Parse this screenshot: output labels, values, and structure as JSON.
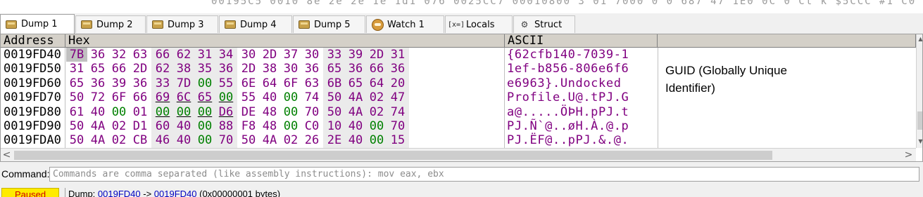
{
  "top_strip": {
    "ghost_text": "00195C5  0010 8e  2e  2e 1e 1d1 076  0025CC7 00010800  3  01  7000  0 0  687 47  1E0  0C 0  Ct  k  $5CCC  #1  C0"
  },
  "tabs": [
    {
      "label": "Dump 1",
      "icon": "dump-icon",
      "active": true
    },
    {
      "label": "Dump 2",
      "icon": "dump-icon",
      "active": false
    },
    {
      "label": "Dump 3",
      "icon": "dump-icon",
      "active": false
    },
    {
      "label": "Dump 4",
      "icon": "dump-icon",
      "active": false
    },
    {
      "label": "Dump 5",
      "icon": "dump-icon",
      "active": false
    },
    {
      "label": "Watch 1",
      "icon": "watch-icon",
      "active": false
    },
    {
      "label": "Locals",
      "icon": "locals-icon",
      "icon_text": "[x=]",
      "active": false
    },
    {
      "label": "Struct",
      "icon": "struct-icon",
      "active": false
    }
  ],
  "dump": {
    "headers": {
      "address": "Address",
      "hex": "Hex",
      "ascii": "ASCII"
    },
    "addresses": [
      "0019FD40",
      "0019FD50",
      "0019FD60",
      "0019FD70",
      "0019FD80",
      "0019FD90",
      "0019FDA0"
    ],
    "hex_rows": [
      [
        "7B",
        "36",
        "32",
        "63",
        "66",
        "62",
        "31",
        "34",
        "30",
        "2D",
        "37",
        "30",
        "33",
        "39",
        "2D",
        "31"
      ],
      [
        "31",
        "65",
        "66",
        "2D",
        "62",
        "38",
        "35",
        "36",
        "2D",
        "38",
        "30",
        "36",
        "65",
        "36",
        "66",
        "36"
      ],
      [
        "65",
        "36",
        "39",
        "36",
        "33",
        "7D",
        "00",
        "55",
        "6E",
        "64",
        "6F",
        "63",
        "6B",
        "65",
        "64",
        "20"
      ],
      [
        "50",
        "72",
        "6F",
        "66",
        "69",
        "6C",
        "65",
        "00",
        "55",
        "40",
        "00",
        "74",
        "50",
        "4A",
        "02",
        "47"
      ],
      [
        "61",
        "40",
        "00",
        "01",
        "00",
        "00",
        "00",
        "D6",
        "DE",
        "48",
        "00",
        "70",
        "50",
        "4A",
        "02",
        "74"
      ],
      [
        "50",
        "4A",
        "02",
        "D1",
        "60",
        "40",
        "00",
        "88",
        "F8",
        "48",
        "00",
        "C0",
        "10",
        "40",
        "00",
        "70"
      ],
      [
        "50",
        "4A",
        "02",
        "CB",
        "46",
        "40",
        "00",
        "70",
        "50",
        "4A",
        "02",
        "26",
        "2E",
        "40",
        "00",
        "15"
      ]
    ],
    "ascii_rows": [
      "{62cfb140-7039-1",
      "1ef-b856-806e6f6",
      "e6963}.Undocked ",
      "Profile.U@.tPJ.G",
      "a@.....ÖÞH.pPJ.t",
      "PJ.Ñ`@..øH.À.@.p",
      "PJ.ËF@..pPJ.&.@."
    ],
    "comment": "GUID (Globally Unique Identifier)",
    "selected_byte": {
      "row": 0,
      "col": 0
    },
    "underlined_bytes": {
      "row": 3,
      "cols": [
        4,
        5,
        6,
        7
      ],
      "row2": 4,
      "cols2": [
        4,
        5,
        6,
        7
      ]
    },
    "colors": {
      "byte": "#800080",
      "zero_byte": "#008000",
      "selection": "#c0c0c0"
    }
  },
  "command": {
    "label": "Command:",
    "placeholder": "Commands are comma separated (like assembly instructions): mov eax, ebx",
    "value": ""
  },
  "status": {
    "state": "Paused",
    "text_prefix": "Dump: ",
    "addr1": "0019FD40",
    "sep": " -> ",
    "addr2": "0019FD40",
    "suffix": " (0x00000001 bytes)",
    "state_color": "#ffeb00"
  }
}
